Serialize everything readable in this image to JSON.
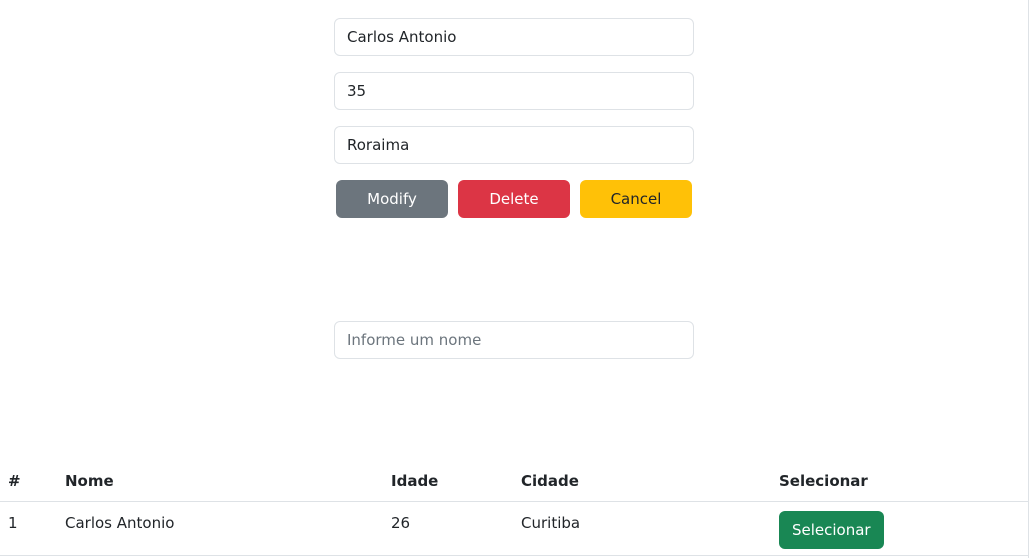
{
  "form": {
    "name_value": "Carlos Antonio",
    "age_value": "35",
    "city_value": "Roraima",
    "buttons": {
      "modify": "Modify",
      "delete": "Delete",
      "cancel": "Cancel"
    }
  },
  "search": {
    "placeholder": "Informe um nome"
  },
  "table": {
    "headers": {
      "hash": "#",
      "nome": "Nome",
      "idade": "Idade",
      "cidade": "Cidade",
      "selecionar": "Selecionar"
    },
    "rows": [
      {
        "id": "1",
        "nome": "Carlos Antonio",
        "idade": "26",
        "cidade": "Curitiba",
        "action": "Selecionar"
      }
    ]
  },
  "colors": {
    "modify": "#6c757d",
    "delete": "#dc3545",
    "cancel": "#ffc107",
    "select": "#198754"
  }
}
